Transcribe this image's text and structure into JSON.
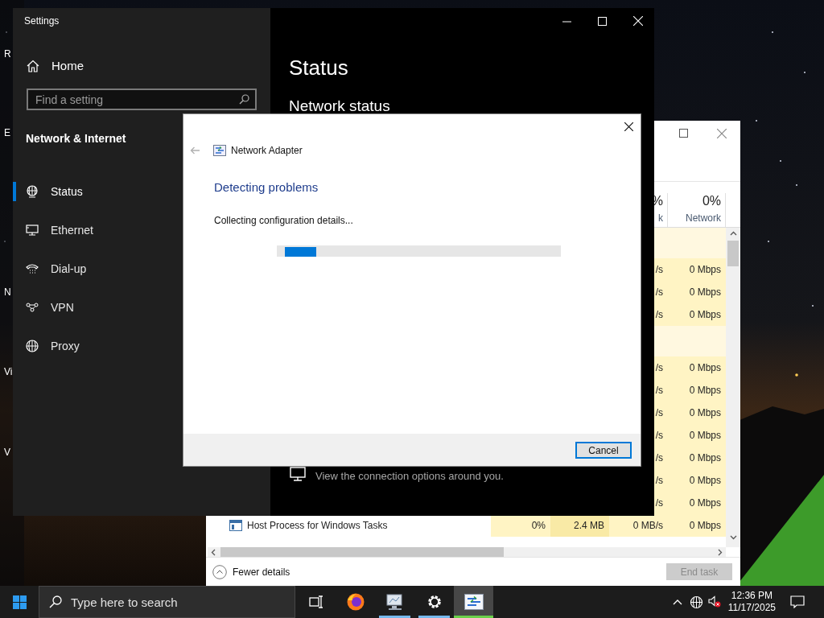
{
  "desktop": {
    "icon_labels": [
      "R",
      "E",
      "N",
      "Vi",
      "V"
    ]
  },
  "settings": {
    "title": "Settings",
    "home": "Home",
    "search": {
      "placeholder": "Find a setting"
    },
    "section": "Network & Internet",
    "nav": [
      {
        "label": "Status",
        "kind": "status",
        "selected": true
      },
      {
        "label": "Ethernet",
        "kind": "ethernet",
        "selected": false
      },
      {
        "label": "Dial-up",
        "kind": "dialup",
        "selected": false
      },
      {
        "label": "VPN",
        "kind": "vpn",
        "selected": false
      },
      {
        "label": "Proxy",
        "kind": "proxy",
        "selected": false
      }
    ],
    "page_title": "Status",
    "subtitle": "Network status",
    "hint": "View the connection options around you."
  },
  "task_manager": {
    "columns": [
      {
        "value": "%",
        "label": "k"
      },
      {
        "value": "0%",
        "label": "Network"
      }
    ],
    "rows": [
      {
        "kind": "group"
      },
      {
        "kind": "process",
        "disk": "/s",
        "network": "0 Mbps"
      },
      {
        "kind": "process",
        "disk": "/s",
        "network": "0 Mbps"
      },
      {
        "kind": "process",
        "disk": "/s",
        "network": "0 Mbps"
      },
      {
        "kind": "group"
      },
      {
        "kind": "process",
        "disk": "/s",
        "network": "0 Mbps"
      },
      {
        "kind": "process",
        "disk": "/s",
        "network": "0 Mbps"
      },
      {
        "kind": "process",
        "disk": "/s",
        "network": "0 Mbps"
      },
      {
        "kind": "process",
        "disk": "/s",
        "network": "0 Mbps"
      },
      {
        "kind": "process",
        "disk": "/s",
        "network": "0 Mbps"
      },
      {
        "kind": "process",
        "disk": "/s",
        "network": "0 Mbps"
      },
      {
        "kind": "process",
        "disk": "/s",
        "network": "0 Mbps"
      },
      {
        "kind": "process",
        "name": "Host Process for Windows Tasks",
        "cpu": "0%",
        "memory": "2.4 MB",
        "disk": "0 MB/s",
        "network": "0 Mbps"
      }
    ],
    "fewer_details": "Fewer details",
    "end_task": {
      "label": "End task",
      "disabled": true
    }
  },
  "dialog": {
    "title": "Network Adapter",
    "heading": "Detecting problems",
    "message": "Collecting configuration details...",
    "progress": {
      "indeterminate": true
    },
    "cancel": "Cancel"
  },
  "taskbar": {
    "search_placeholder": "Type here to search",
    "apps": [
      {
        "kind": "taskview",
        "running": false,
        "selected": false
      },
      {
        "kind": "firefox",
        "running": false,
        "selected": false
      },
      {
        "kind": "network",
        "running": true,
        "selected": false
      },
      {
        "kind": "settings",
        "running": true,
        "selected": false
      },
      {
        "kind": "adapter",
        "running": true,
        "selected": true
      }
    ],
    "time": "12:36 PM",
    "date": "11/17/2025"
  }
}
